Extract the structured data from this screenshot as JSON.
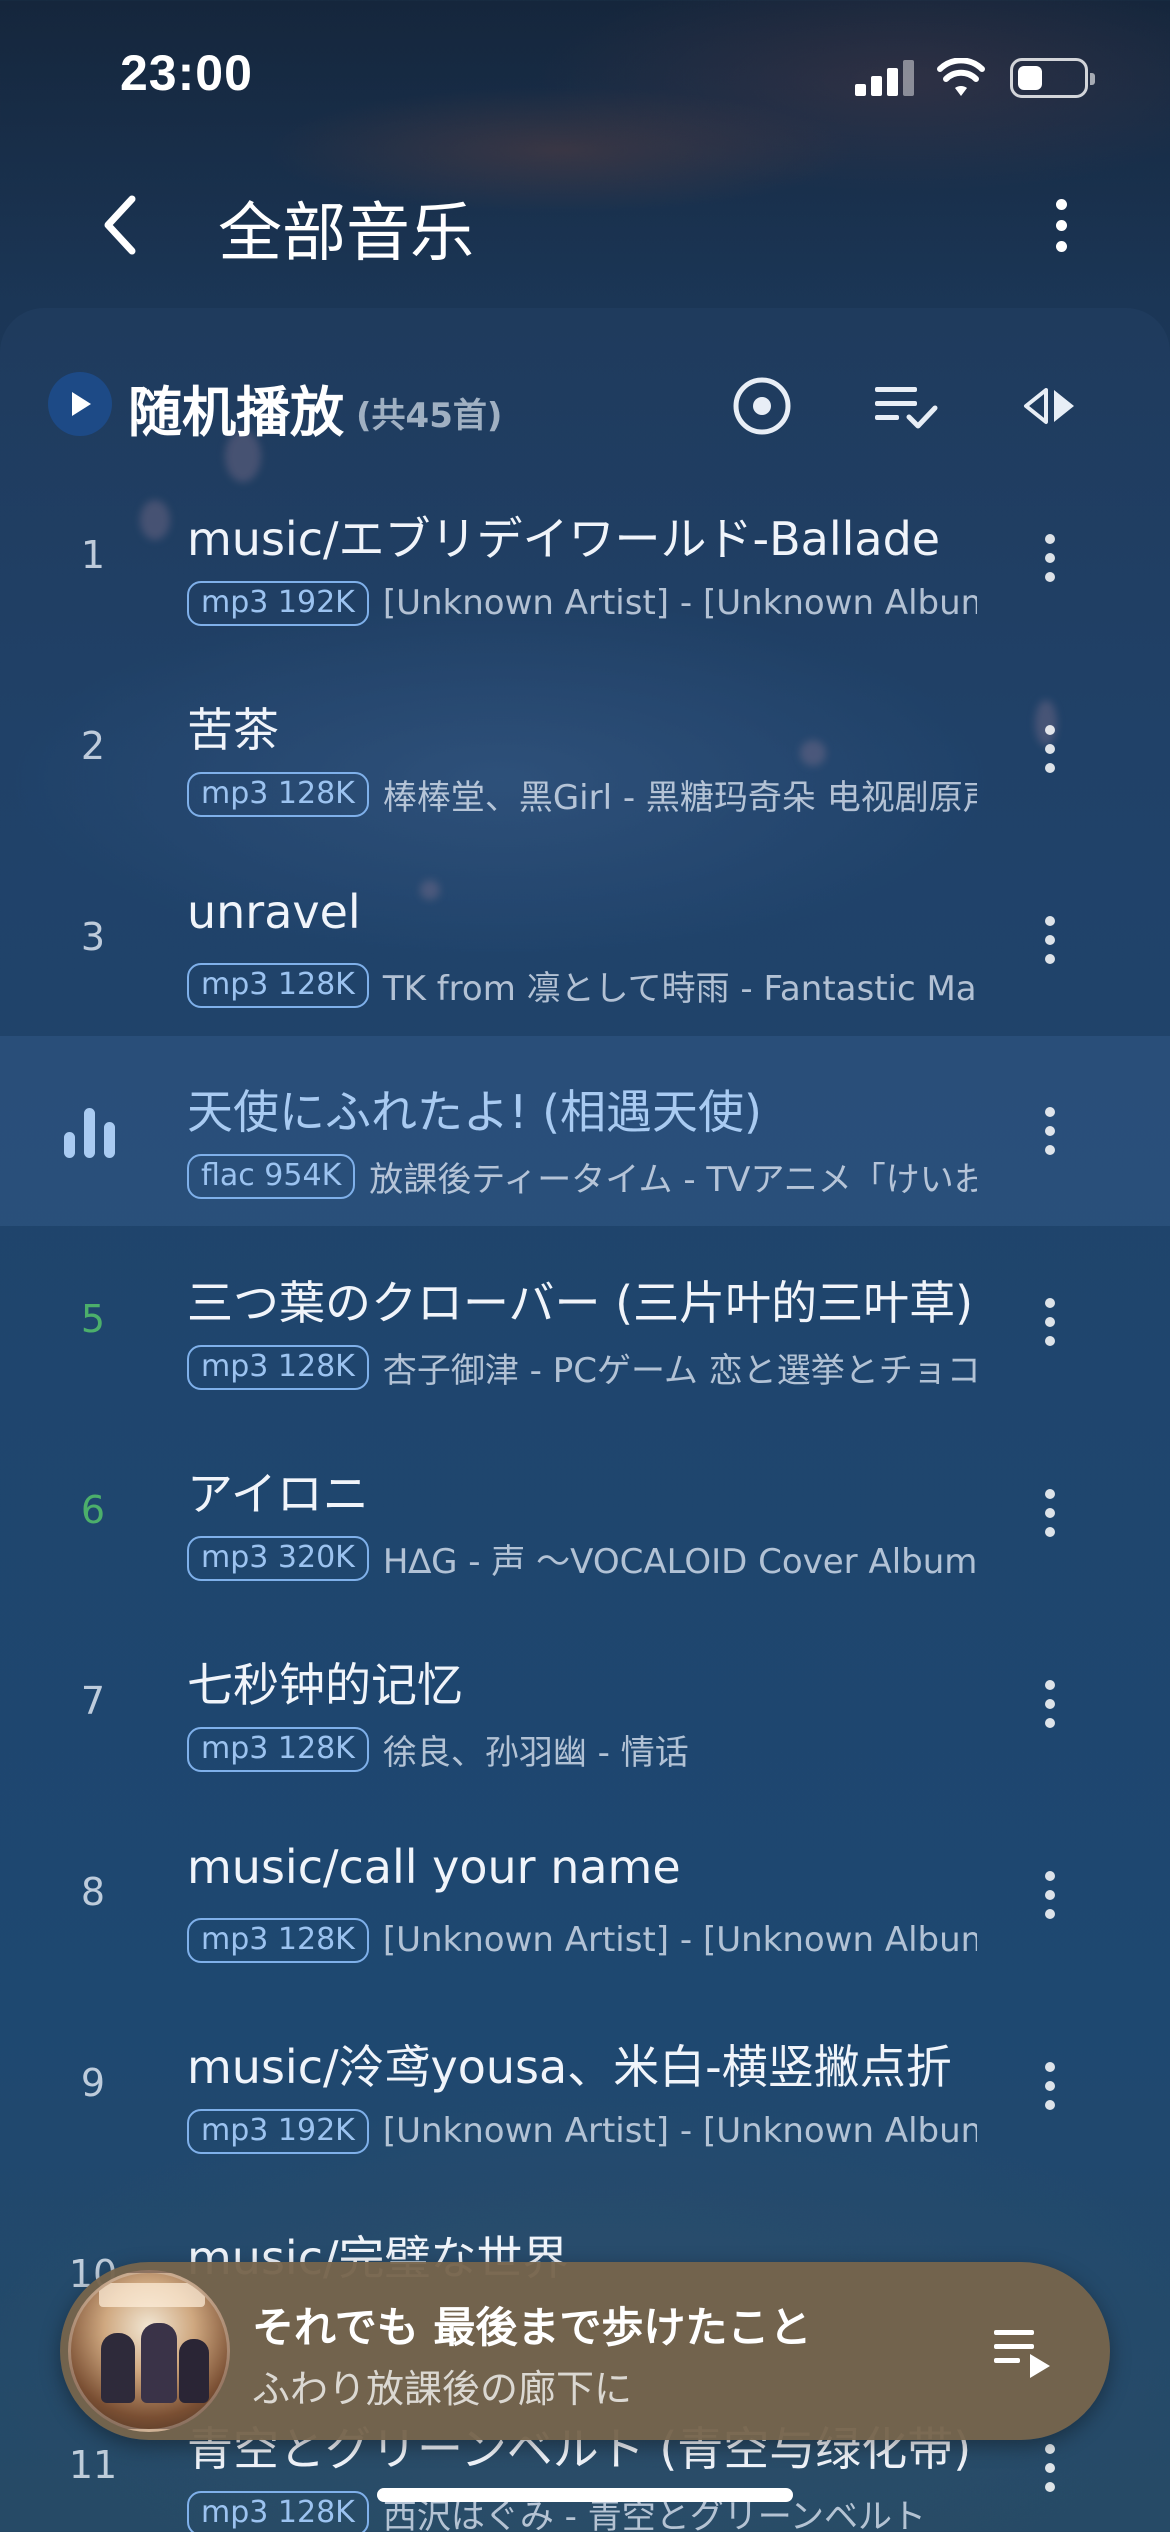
{
  "status_bar": {
    "time": "23:00"
  },
  "header": {
    "title": "全部音乐"
  },
  "toolbar": {
    "shuffle_label": "随机播放",
    "count_label": "(共45首)"
  },
  "songs": [
    {
      "index": "1",
      "title": "music/エブリデイワールド-Ballade",
      "format": "mp3 192K",
      "artist": "[Unknown Artist] - [Unknown Album]"
    },
    {
      "index": "2",
      "title": "苦茶",
      "format": "mp3 128K",
      "artist": "棒棒堂、黑Girl - 黑糖玛奇朵 电视剧原声带"
    },
    {
      "index": "3",
      "title": "unravel",
      "format": "mp3 128K",
      "artist": "TK from 凛として時雨 - Fantastic Magic"
    },
    {
      "index": "",
      "title": "天使にふれたよ! (相遇天使)",
      "format": "flac 954K",
      "artist": "放課後ティータイム - TVアニメ「けいおん!!」"
    },
    {
      "index": "5",
      "title": "三つ葉のクローバー (三片叶的三叶草)",
      "format": "mp3 128K",
      "artist": "杏子御津 - PCゲーム 恋と選挙とチョコレート"
    },
    {
      "index": "6",
      "title": "アイロニ",
      "format": "mp3 320K",
      "artist": "H∆G - 声 ～VOCALOID Cover Album～"
    },
    {
      "index": "7",
      "title": "七秒钟的记忆",
      "format": "mp3 128K",
      "artist": "徐良、孙羽幽 - 情话"
    },
    {
      "index": "8",
      "title": "music/call your name",
      "format": "mp3 128K",
      "artist": "[Unknown Artist] - [Unknown Album]"
    },
    {
      "index": "9",
      "title": "music/泠鸢yousa、米白-横竖撇点折",
      "format": "mp3 192K",
      "artist": "[Unknown Artist] - [Unknown Album]"
    },
    {
      "index": "10",
      "title": "music/完璧な世界",
      "format": "",
      "artist": ""
    },
    {
      "index": "11",
      "title": "青空とグリーンベルト (青空与绿化带)",
      "format": "mp3 128K",
      "artist": "西沢はぐみ - 青空とグリーンベルト"
    }
  ],
  "mini_player": {
    "title": "それでも 最後まで歩けたこと",
    "subtitle": "ふわり放課後の廊下に"
  },
  "colors": {
    "accent_blue": "#a9cbf2",
    "badge_border": "#7fb0ea",
    "number_green": "#4caf6b",
    "player_bg": "#76644c"
  }
}
